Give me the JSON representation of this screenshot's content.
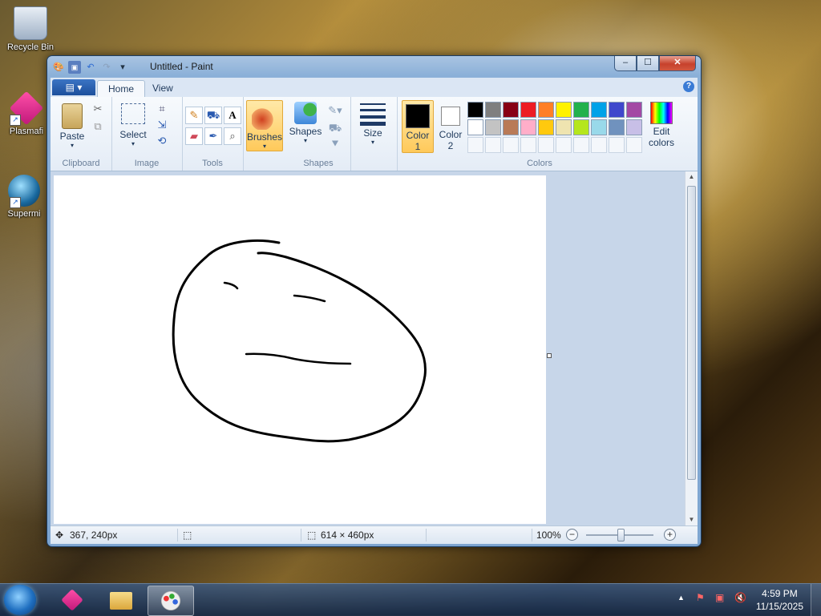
{
  "desktop": {
    "icons": [
      {
        "label": "Recycle Bin"
      },
      {
        "label": "Plasmafi"
      },
      {
        "label": "Supermi"
      }
    ]
  },
  "window": {
    "title": "Untitled - Paint",
    "controls": {
      "minimize": "–",
      "maximize": "☐",
      "close": "✕"
    }
  },
  "ribbon": {
    "tabs": [
      {
        "label": "Home",
        "active": true
      },
      {
        "label": "View",
        "active": false
      }
    ],
    "groups": {
      "clipboard": {
        "label": "Clipboard",
        "paste": "Paste"
      },
      "image": {
        "label": "Image",
        "select": "Select"
      },
      "tools": {
        "label": "Tools"
      },
      "brushes": {
        "label": "Brushes"
      },
      "shapes": {
        "label": "Shapes",
        "button": "Shapes"
      },
      "size": {
        "label": "Size"
      },
      "colors": {
        "label": "Colors",
        "color1": "Color\n1",
        "color1_l1": "Color",
        "color1_l2": "1",
        "color2_l1": "Color",
        "color2_l2": "2",
        "edit_l1": "Edit",
        "edit_l2": "colors",
        "palette_row1": [
          "#000000",
          "#7f7f7f",
          "#880015",
          "#ed1c24",
          "#ff7f27",
          "#fff200",
          "#22b14c",
          "#00a2e8",
          "#3f48cc",
          "#a349a4"
        ],
        "palette_row2": [
          "#ffffff",
          "#c3c3c3",
          "#b97a57",
          "#ffaec9",
          "#ffc90e",
          "#efe4b0",
          "#b5e61d",
          "#99d9ea",
          "#7092be",
          "#c8bfe7"
        ],
        "color1_value": "#000000",
        "color2_value": "#ffffff"
      }
    }
  },
  "status": {
    "cursor_pos": "367, 240px",
    "canvas_size": "614 × 460px",
    "zoom": "100%"
  },
  "taskbar": {
    "time": "4:59 PM",
    "date": "11/15/2025"
  }
}
